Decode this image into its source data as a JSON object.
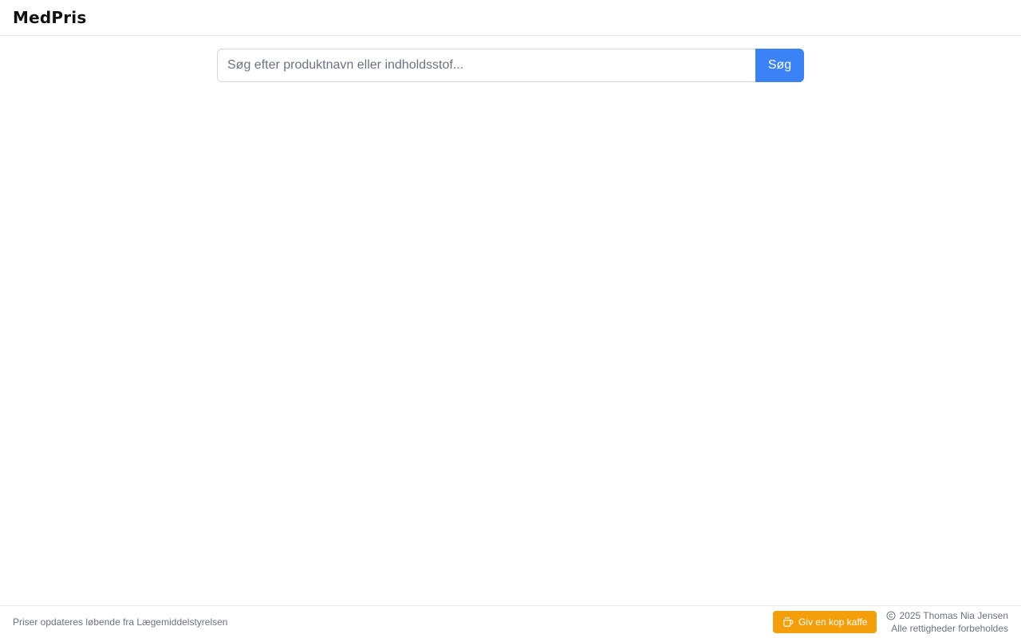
{
  "header": {
    "logo": "MedPris"
  },
  "search": {
    "placeholder": "Søg efter produktnavn eller indholdsstof...",
    "value": "",
    "button_label": "Søg"
  },
  "footer": {
    "note": "Priser opdateres løbende fra Lægemiddelstyrelsen",
    "coffee_button": {
      "label": "Giv en kop kaffe",
      "icon": "coffee-icon"
    },
    "copyright": {
      "icon": "copyright-icon",
      "line1": "2025 Thomas Nia Jensen",
      "line2": "Alle rettigheder forbeholdes"
    }
  },
  "colors": {
    "accent": "#3b82f6",
    "coffee": "#f59e0b",
    "border": "#e5e7eb",
    "muted_text": "#6b7280"
  }
}
